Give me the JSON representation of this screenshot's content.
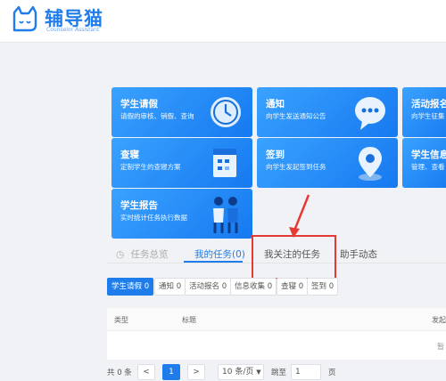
{
  "brand": {
    "name": "辅导猫",
    "subtitle": "Counselor Assistant"
  },
  "cards": [
    {
      "title": "学生请假",
      "desc": "请假的审核、销假、查询",
      "icon": "clock-icon"
    },
    {
      "title": "通知",
      "desc": "向学生发送通知公告",
      "icon": "chat-bubble-icon"
    },
    {
      "title": "活动报名",
      "desc": "向学生征集",
      "icon": "activity-icon"
    },
    {
      "title": "查寝",
      "desc": "定制学生的查寝方案",
      "icon": "calendar-icon"
    },
    {
      "title": "签到",
      "desc": "向学生发起签到任务",
      "icon": "location-pin-icon"
    },
    {
      "title": "学生信息",
      "desc": "管理、查看",
      "icon": "person-info-icon"
    },
    {
      "title": "学生报告",
      "desc": "实时统计任务执行数据",
      "icon": "people-icon"
    }
  ],
  "tabs": [
    {
      "label": "任务总览",
      "state": "disabled"
    },
    {
      "label": "我的任务(0)",
      "state": "active"
    },
    {
      "label": "我关注的任务",
      "state": "normal"
    },
    {
      "label": "助手动态",
      "state": "normal"
    }
  ],
  "filters": [
    {
      "label": "学生请假 0",
      "active": true
    },
    {
      "label": "通知 0",
      "active": false
    },
    {
      "label": "活动报名 0",
      "active": false
    },
    {
      "label": "信息收集 0",
      "active": false
    },
    {
      "label": "查寝 0",
      "active": false
    },
    {
      "label": "签到 0",
      "active": false
    }
  ],
  "table": {
    "columns": [
      "类型",
      "标题",
      "发起"
    ],
    "empty_text": "暂"
  },
  "pagination": {
    "total": "共 0 条",
    "prev": "<",
    "current": "1",
    "next": ">",
    "page_size": "10 条/页",
    "goto_label": "跳至",
    "goto_value": "1",
    "page_unit": "页"
  },
  "colors": {
    "accent": "#1e7dea",
    "annotation": "#e53935"
  }
}
